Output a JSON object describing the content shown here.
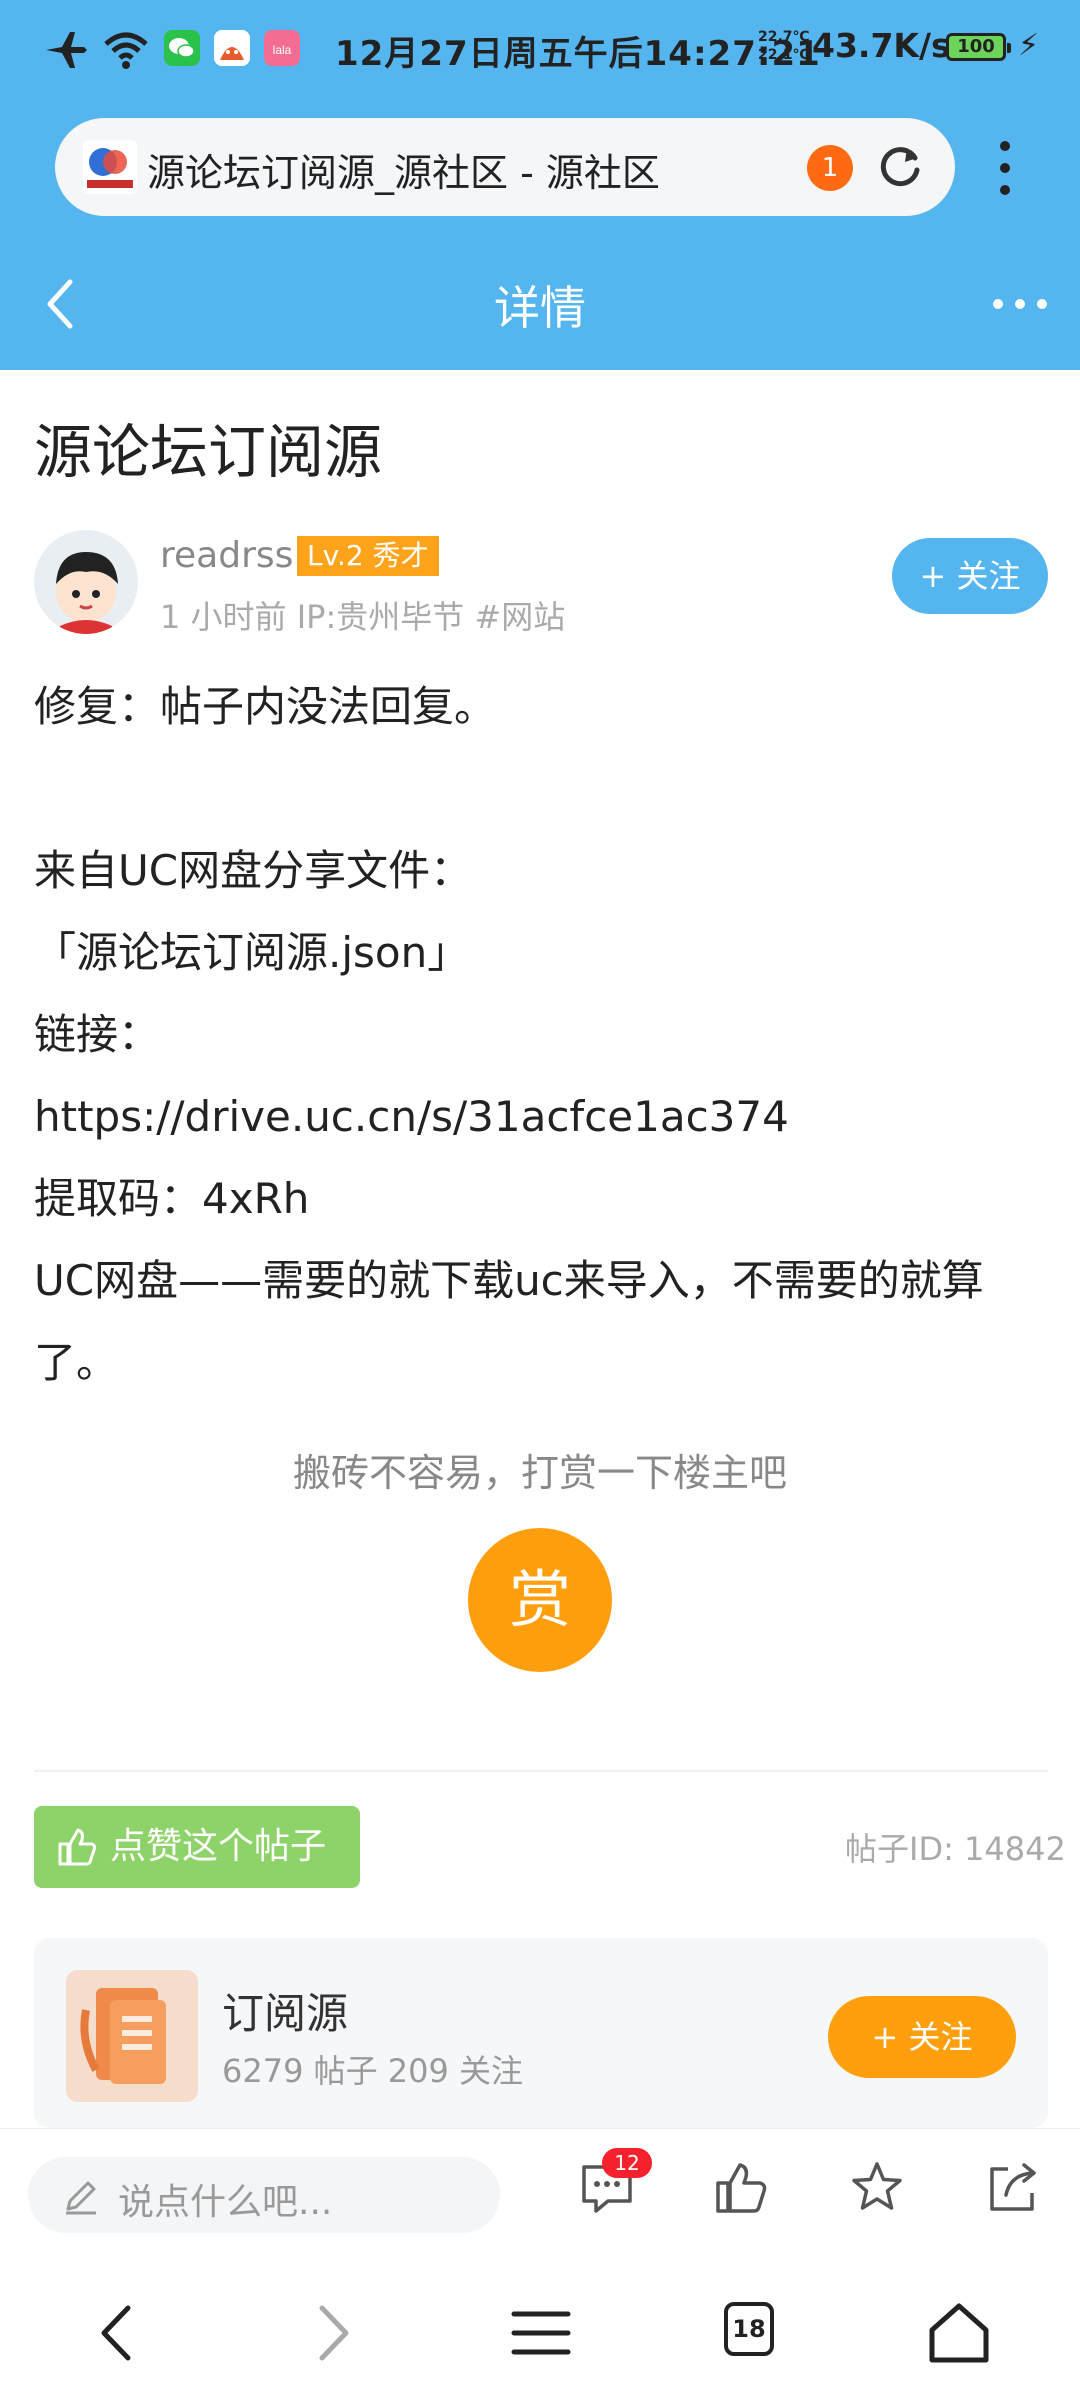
{
  "status_bar": {
    "time": "12月27日周五午后14:27:21",
    "temp_high": "22.7℃",
    "temp_low": "22.1℃",
    "net_speed": "43.7K/s",
    "battery": "100",
    "icons": [
      "airplane-icon",
      "wifi-icon",
      "wechat-icon",
      "app-icon",
      "lala-icon",
      "charging-icon"
    ]
  },
  "browser": {
    "page_title": "源论坛订阅源_源社区 - 源社区",
    "notification_count": "1"
  },
  "navbar": {
    "title": "详情"
  },
  "post": {
    "title": "源论坛订阅源",
    "author": "readrss",
    "level": "Lv.2 秀才",
    "meta": "1 小时前  IP:贵州毕节 #网站",
    "follow_label": "+ 关注",
    "lines": [
      "修复：帖子内没法回复。",
      "来自UC网盘分享文件：",
      "「源论坛订阅源.json」",
      "链接：",
      "https://drive.uc.cn/s/31acfce1ac374",
      "提取码：4xRh",
      "UC网盘——需要的就下载uc来导入，不需要的就算了。"
    ],
    "reward_tip": "搬砖不容易，打赏一下楼主吧",
    "reward_label": "赏",
    "like_label": "点赞这个帖子",
    "post_id": "帖子ID: 14842"
  },
  "topic": {
    "name": "订阅源",
    "stats": "6279 帖子   209 关注",
    "follow_label": "+ 关注"
  },
  "bottom_bar": {
    "comment_placeholder": "说点什么吧...",
    "comment_count": "12"
  },
  "system_nav": {
    "tab_count": "18"
  },
  "colors": {
    "header_blue": "#55b5ee",
    "orange": "#ff9f0e",
    "green": "#8ed36a",
    "badge_red": "#f5222d"
  }
}
